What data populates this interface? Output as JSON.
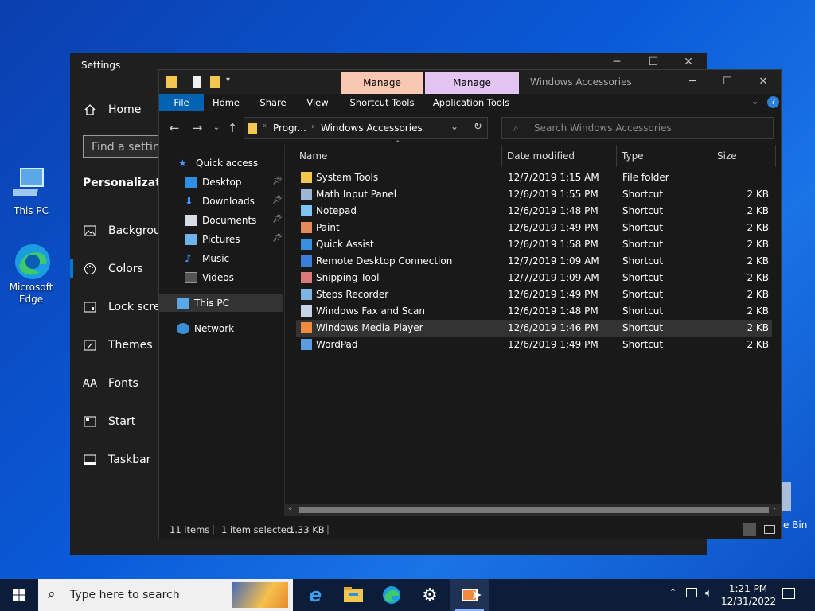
{
  "desktop": {
    "icons": [
      {
        "label": "This PC"
      },
      {
        "label": "Microsoft Edge"
      }
    ],
    "recycle_bin_partial": "e Bin"
  },
  "settings": {
    "title": "Settings",
    "home": "Home",
    "search_placeholder": "Find a setting",
    "heading": "Personalization",
    "items": [
      "Background",
      "Colors",
      "Lock screen",
      "Themes",
      "Fonts",
      "Start",
      "Taskbar"
    ]
  },
  "explorer": {
    "title": "Windows Accessories",
    "manage_tabs": [
      {
        "label": "Manage",
        "color": "#f9c8b2"
      },
      {
        "label": "Manage",
        "color": "#e3c4f3"
      }
    ],
    "ribbon_tabs": [
      "File",
      "Home",
      "Share",
      "View",
      "Shortcut Tools",
      "Application Tools"
    ],
    "address": {
      "crumb1": "Progr...",
      "crumb2": "Windows Accessories"
    },
    "search_placeholder": "Search Windows Accessories",
    "nav": {
      "quick_access": "Quick access",
      "items": [
        "Desktop",
        "Downloads",
        "Documents",
        "Pictures",
        "Music",
        "Videos"
      ],
      "this_pc": "This PC",
      "network": "Network"
    },
    "columns": [
      "Name",
      "Date modified",
      "Type",
      "Size"
    ],
    "files": [
      {
        "name": "System Tools",
        "date": "12/7/2019 1:15 AM",
        "type": "File folder",
        "size": ""
      },
      {
        "name": "Math Input Panel",
        "date": "12/6/2019 1:55 PM",
        "type": "Shortcut",
        "size": "2 KB"
      },
      {
        "name": "Notepad",
        "date": "12/6/2019 1:48 PM",
        "type": "Shortcut",
        "size": "2 KB"
      },
      {
        "name": "Paint",
        "date": "12/6/2019 1:49 PM",
        "type": "Shortcut",
        "size": "2 KB"
      },
      {
        "name": "Quick Assist",
        "date": "12/6/2019 1:58 PM",
        "type": "Shortcut",
        "size": "2 KB"
      },
      {
        "name": "Remote Desktop Connection",
        "date": "12/7/2019 1:09 AM",
        "type": "Shortcut",
        "size": "2 KB"
      },
      {
        "name": "Snipping Tool",
        "date": "12/7/2019 1:09 AM",
        "type": "Shortcut",
        "size": "2 KB"
      },
      {
        "name": "Steps Recorder",
        "date": "12/6/2019 1:49 PM",
        "type": "Shortcut",
        "size": "2 KB"
      },
      {
        "name": "Windows Fax and Scan",
        "date": "12/6/2019 1:48 PM",
        "type": "Shortcut",
        "size": "2 KB"
      },
      {
        "name": "Windows Media Player",
        "date": "12/6/2019 1:46 PM",
        "type": "Shortcut",
        "size": "2 KB"
      },
      {
        "name": "WordPad",
        "date": "12/6/2019 1:49 PM",
        "type": "Shortcut",
        "size": "2 KB"
      }
    ],
    "status": {
      "count": "11 items",
      "selected": "1 item selected",
      "size": "1.33 KB"
    }
  },
  "taskbar": {
    "search_placeholder": "Type here to search",
    "time": "1:21 PM",
    "date": "12/31/2022"
  },
  "colors": {
    "accent": "#0078d4",
    "folder": "#f3c64f"
  }
}
